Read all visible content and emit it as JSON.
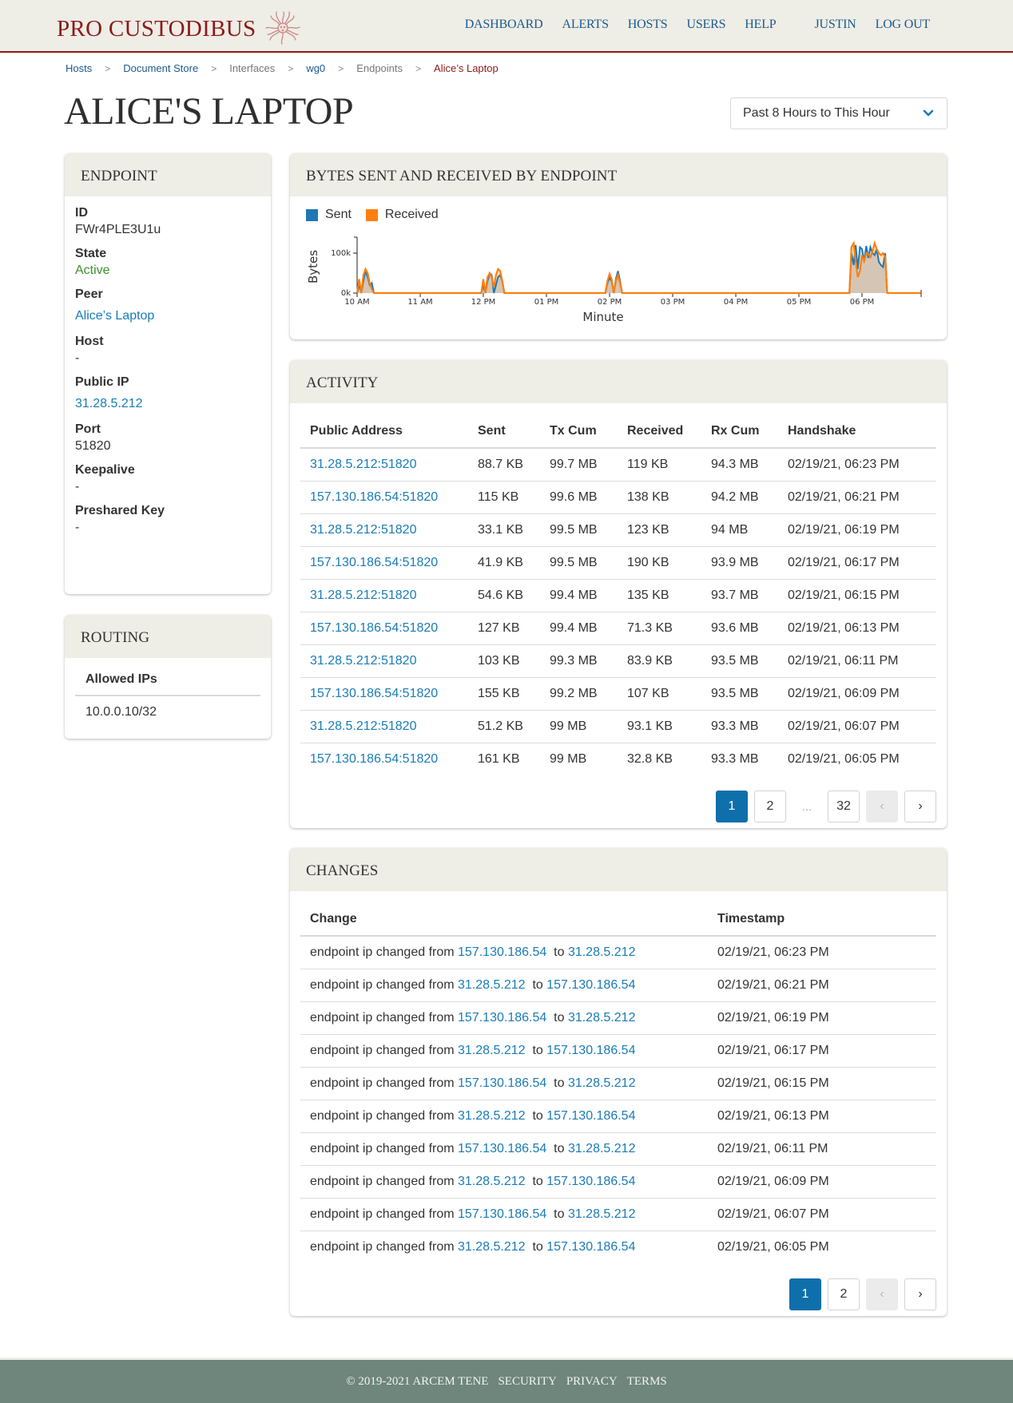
{
  "header": {
    "brand": "PRO CUSTODIBUS",
    "logo_icon": "medusa-logo",
    "nav": [
      {
        "label": "DASHBOARD"
      },
      {
        "label": "ALERTS"
      },
      {
        "label": "HOSTS"
      },
      {
        "label": "USERS"
      },
      {
        "label": "HELP"
      }
    ],
    "user": "JUSTIN",
    "logout": "LOG OUT"
  },
  "breadcrumb": [
    {
      "label": "Hosts",
      "kind": "link"
    },
    {
      "label": "Document Store",
      "kind": "link"
    },
    {
      "label": "Interfaces",
      "kind": "plain"
    },
    {
      "label": "wg0",
      "kind": "link"
    },
    {
      "label": "Endpoints",
      "kind": "plain"
    },
    {
      "label": "Alice’s Laptop",
      "kind": "current"
    }
  ],
  "breadcrumb_separator": ">",
  "page_title": "ALICE'S LAPTOP",
  "time_range": {
    "selected": "Past 8 Hours to This Hour"
  },
  "endpoint": {
    "title": "ENDPOINT",
    "fields": [
      {
        "label": "ID",
        "value": "FWr4PLE3U1u",
        "style": "plain"
      },
      {
        "label": "State",
        "value": "Active",
        "style": "green"
      },
      {
        "label": "Peer",
        "value": "Alice’s Laptop",
        "style": "link"
      },
      {
        "label": "Host",
        "value": "-",
        "style": "plain"
      },
      {
        "label": "Public IP",
        "value": "31.28.5.212",
        "style": "link"
      },
      {
        "label": "Port",
        "value": "51820",
        "style": "plain"
      },
      {
        "label": "Keepalive",
        "value": "-",
        "style": "plain"
      },
      {
        "label": "Preshared Key",
        "value": "-",
        "style": "plain"
      }
    ]
  },
  "routing": {
    "title": "ROUTING",
    "column": "Allowed IPs",
    "rows": [
      "10.0.0.10/32"
    ]
  },
  "colors": {
    "sent": "#1f77b4",
    "received": "#ff7f0e",
    "link": "#1a7bb5",
    "brand": "#8b1a1a",
    "active_green": "#3c8f2a",
    "pager_active": "#0f6fab"
  },
  "chart_data": {
    "type": "area",
    "title": "BYTES SENT AND RECEIVED BY ENDPOINT",
    "xlabel": "Minute",
    "ylabel": "Bytes",
    "x_ticks": [
      "10 AM",
      "11 AM",
      "12 PM",
      "01 PM",
      "02 PM",
      "03 PM",
      "04 PM",
      "05 PM",
      "06 PM"
    ],
    "y_ticks": [
      "0k",
      "100k"
    ],
    "ylim": [
      0,
      140000
    ],
    "xlim_minutes_from_10am": [
      0,
      480
    ],
    "legend": [
      "Sent",
      "Received"
    ],
    "legend_position": "top-left",
    "series": [
      {
        "name": "Sent",
        "points": [
          [
            0,
            0
          ],
          [
            2,
            20000
          ],
          [
            4,
            0
          ],
          [
            6,
            30000
          ],
          [
            8,
            55000
          ],
          [
            10,
            40000
          ],
          [
            12,
            20000
          ],
          [
            14,
            25000
          ],
          [
            16,
            0
          ],
          [
            118,
            0
          ],
          [
            120,
            20000
          ],
          [
            122,
            0
          ],
          [
            124,
            30000
          ],
          [
            126,
            50000
          ],
          [
            128,
            45000
          ],
          [
            130,
            0
          ],
          [
            132,
            20000
          ],
          [
            134,
            40000
          ],
          [
            136,
            45000
          ],
          [
            138,
            30000
          ],
          [
            140,
            0
          ],
          [
            236,
            0
          ],
          [
            238,
            25000
          ],
          [
            240,
            38000
          ],
          [
            242,
            30000
          ],
          [
            244,
            0
          ],
          [
            246,
            35000
          ],
          [
            248,
            55000
          ],
          [
            250,
            30000
          ],
          [
            252,
            0
          ],
          [
            468,
            0
          ],
          [
            470,
            100000
          ],
          [
            472,
            70000
          ],
          [
            474,
            120000
          ],
          [
            476,
            60000
          ],
          [
            478,
            115000
          ],
          [
            480,
            110000
          ],
          [
            482,
            80000
          ],
          [
            484,
            118000
          ],
          [
            486,
            88000
          ],
          [
            488,
            115000
          ],
          [
            490,
            100000
          ],
          [
            492,
            95000
          ],
          [
            494,
            110000
          ],
          [
            496,
            78000
          ],
          [
            498,
            70000
          ],
          [
            500,
            65000
          ],
          [
            502,
            100000
          ],
          [
            504,
            0
          ]
        ]
      },
      {
        "name": "Received",
        "points": [
          [
            0,
            0
          ],
          [
            2,
            35000
          ],
          [
            4,
            0
          ],
          [
            6,
            45000
          ],
          [
            8,
            60000
          ],
          [
            10,
            50000
          ],
          [
            12,
            25000
          ],
          [
            14,
            10000
          ],
          [
            16,
            0
          ],
          [
            118,
            0
          ],
          [
            120,
            35000
          ],
          [
            122,
            0
          ],
          [
            124,
            40000
          ],
          [
            126,
            50000
          ],
          [
            128,
            40000
          ],
          [
            130,
            15000
          ],
          [
            132,
            45000
          ],
          [
            134,
            60000
          ],
          [
            136,
            55000
          ],
          [
            138,
            30000
          ],
          [
            140,
            0
          ],
          [
            236,
            0
          ],
          [
            238,
            30000
          ],
          [
            240,
            48000
          ],
          [
            242,
            35000
          ],
          [
            244,
            0
          ],
          [
            246,
            30000
          ],
          [
            248,
            45000
          ],
          [
            250,
            25000
          ],
          [
            252,
            0
          ],
          [
            468,
            0
          ],
          [
            470,
            115000
          ],
          [
            472,
            125000
          ],
          [
            474,
            80000
          ],
          [
            476,
            40000
          ],
          [
            478,
            55000
          ],
          [
            480,
            95000
          ],
          [
            482,
            80000
          ],
          [
            484,
            100000
          ],
          [
            486,
            98000
          ],
          [
            488,
            90000
          ],
          [
            490,
            105000
          ],
          [
            492,
            125000
          ],
          [
            494,
            110000
          ],
          [
            496,
            100000
          ],
          [
            498,
            95000
          ],
          [
            500,
            100000
          ],
          [
            502,
            90000
          ],
          [
            504,
            0
          ]
        ]
      }
    ]
  },
  "activity": {
    "title": "ACTIVITY",
    "columns": [
      "Public Address",
      "Sent",
      "Tx Cum",
      "Received",
      "Rx Cum",
      "Handshake"
    ],
    "rows": [
      [
        "31.28.5.212:51820",
        "88.7 KB",
        "99.7 MB",
        "119 KB",
        "94.3 MB",
        "02/19/21, 06:23 PM"
      ],
      [
        "157.130.186.54:51820",
        "115 KB",
        "99.6 MB",
        "138 KB",
        "94.2 MB",
        "02/19/21, 06:21 PM"
      ],
      [
        "31.28.5.212:51820",
        "33.1 KB",
        "99.5 MB",
        "123 KB",
        "94 MB",
        "02/19/21, 06:19 PM"
      ],
      [
        "157.130.186.54:51820",
        "41.9 KB",
        "99.5 MB",
        "190 KB",
        "93.9 MB",
        "02/19/21, 06:17 PM"
      ],
      [
        "31.28.5.212:51820",
        "54.6 KB",
        "99.4 MB",
        "135 KB",
        "93.7 MB",
        "02/19/21, 06:15 PM"
      ],
      [
        "157.130.186.54:51820",
        "127 KB",
        "99.4 MB",
        "71.3 KB",
        "93.6 MB",
        "02/19/21, 06:13 PM"
      ],
      [
        "31.28.5.212:51820",
        "103 KB",
        "99.3 MB",
        "83.9 KB",
        "93.5 MB",
        "02/19/21, 06:11 PM"
      ],
      [
        "157.130.186.54:51820",
        "155 KB",
        "99.2 MB",
        "107 KB",
        "93.5 MB",
        "02/19/21, 06:09 PM"
      ],
      [
        "31.28.5.212:51820",
        "51.2 KB",
        "99 MB",
        "93.1 KB",
        "93.3 MB",
        "02/19/21, 06:07 PM"
      ],
      [
        "157.130.186.54:51820",
        "161 KB",
        "99 MB",
        "32.8 KB",
        "93.3 MB",
        "02/19/21, 06:05 PM"
      ]
    ],
    "pagination": {
      "pages": [
        "1",
        "2",
        "…",
        "32"
      ],
      "current": "1",
      "prev": "‹",
      "next": "›"
    }
  },
  "changes": {
    "title": "CHANGES",
    "columns": [
      "Change",
      "Timestamp"
    ],
    "prefix": "endpoint ip changed from",
    "joiner": "to",
    "rows": [
      {
        "from": "157.130.186.54",
        "to": "31.28.5.212",
        "timestamp": "02/19/21, 06:23 PM"
      },
      {
        "from": "31.28.5.212",
        "to": "157.130.186.54",
        "timestamp": "02/19/21, 06:21 PM"
      },
      {
        "from": "157.130.186.54",
        "to": "31.28.5.212",
        "timestamp": "02/19/21, 06:19 PM"
      },
      {
        "from": "31.28.5.212",
        "to": "157.130.186.54",
        "timestamp": "02/19/21, 06:17 PM"
      },
      {
        "from": "157.130.186.54",
        "to": "31.28.5.212",
        "timestamp": "02/19/21, 06:15 PM"
      },
      {
        "from": "31.28.5.212",
        "to": "157.130.186.54",
        "timestamp": "02/19/21, 06:13 PM"
      },
      {
        "from": "157.130.186.54",
        "to": "31.28.5.212",
        "timestamp": "02/19/21, 06:11 PM"
      },
      {
        "from": "31.28.5.212",
        "to": "157.130.186.54",
        "timestamp": "02/19/21, 06:09 PM"
      },
      {
        "from": "157.130.186.54",
        "to": "31.28.5.212",
        "timestamp": "02/19/21, 06:07 PM"
      },
      {
        "from": "31.28.5.212",
        "to": "157.130.186.54",
        "timestamp": "02/19/21, 06:05 PM"
      }
    ],
    "pagination": {
      "pages": [
        "1",
        "2"
      ],
      "current": "1",
      "prev": "‹",
      "next": "›"
    }
  },
  "footer": {
    "copyright": "© 2019-2021 ARCEM TENE",
    "links": [
      "SECURITY",
      "PRIVACY",
      "TERMS"
    ]
  }
}
